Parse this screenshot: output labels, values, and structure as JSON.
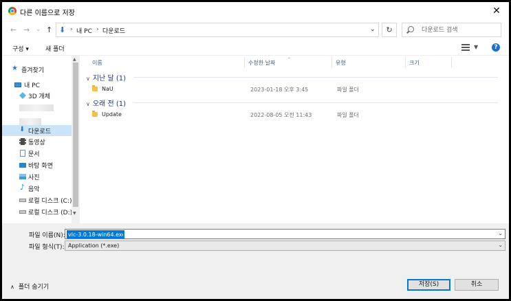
{
  "window": {
    "title": "다른 이름으로 저장",
    "close_glyph": "✕"
  },
  "nav": {
    "back_glyph": "←",
    "forward_glyph": "→",
    "recent_glyph": "⌄",
    "up_glyph": "↑",
    "breadcrumb": [
      "내 PC",
      "다운로드"
    ],
    "breadcrumb_separator": "›",
    "dropdown_glyph": "⌄",
    "refresh_glyph": "↻",
    "search_placeholder": "다운로드 검색"
  },
  "toolbar": {
    "organize_label": "구성 ▾",
    "new_folder_label": "새 폴더",
    "help_glyph": "?"
  },
  "sidebar": {
    "items": [
      {
        "label": "즐겨찾기",
        "icon": "star-icon"
      },
      {
        "label": "내 PC",
        "icon": "computer-icon"
      },
      {
        "label": "3D 개체",
        "icon": "3d-objects-icon"
      },
      {
        "label": "다운로드",
        "icon": "download-icon",
        "selected": true
      },
      {
        "label": "동영상",
        "icon": "video-icon"
      },
      {
        "label": "문서",
        "icon": "document-icon"
      },
      {
        "label": "바탕 화면",
        "icon": "desktop-icon"
      },
      {
        "label": "사진",
        "icon": "pictures-icon"
      },
      {
        "label": "음악",
        "icon": "music-icon"
      },
      {
        "label": "로컬 디스크 (C:)",
        "icon": "drive-icon"
      },
      {
        "label": "로컬 디스크 (D:)",
        "icon": "drive-icon"
      }
    ]
  },
  "columns": {
    "name": "이름",
    "modified": "수정한 날짜",
    "type": "유형",
    "size": "크기"
  },
  "groups": [
    {
      "header": "지난 달 (1)",
      "files": [
        {
          "name": "NaU",
          "modified": "2023-01-18 오후 3:45",
          "type": "파일 폴더"
        }
      ]
    },
    {
      "header": "오래 전 (1)",
      "files": [
        {
          "name": "Update",
          "modified": "2022-08-05 오전 11:43",
          "type": "파일 폴더"
        }
      ]
    }
  ],
  "form": {
    "filename_label": "파일 이름(N):",
    "filename_value": "vlc-3.0.18-win64.exe",
    "filetype_label": "파일 형식(T):",
    "filetype_value": "Application (*.exe)"
  },
  "footer": {
    "hide_folders_label": "폴더 숨기기",
    "save_label": "저장(S)",
    "cancel_label": "취소"
  },
  "colors": {
    "accent": "#0078d7",
    "selection": "#cce4f7",
    "group_header": "#1e3287"
  }
}
